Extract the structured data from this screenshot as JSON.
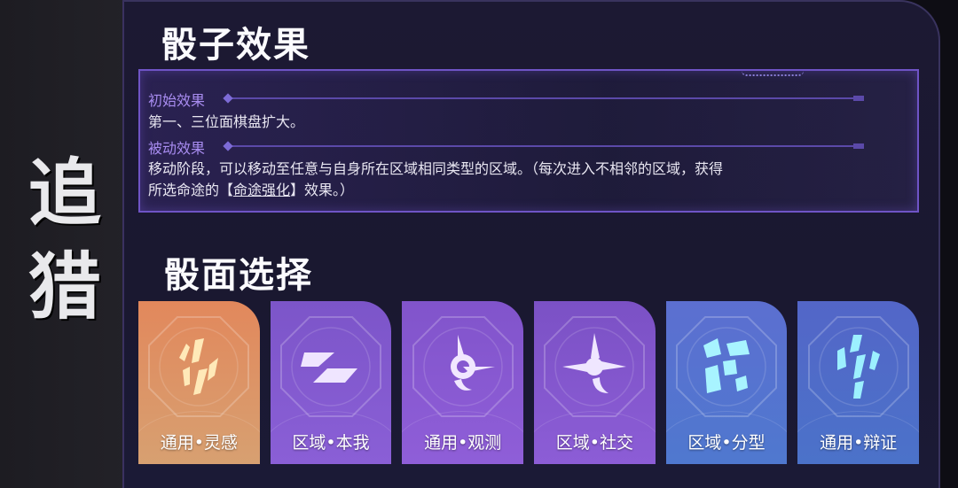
{
  "side_title": [
    "追",
    "猎"
  ],
  "dice_effect": {
    "title": "骰子效果",
    "initial_label": "初始效果",
    "initial_text": "第一、三位面棋盘扩大。",
    "passive_label": "被动效果",
    "passive_text_1": "移动阶段，可以移动至任意与自身所在区域相同类型的区域。（每次进入不相邻的区域，获得",
    "passive_text_2a": "所选命途的【",
    "passive_text_2b": "命途强化",
    "passive_text_2c": "】效果。）"
  },
  "face_select": {
    "title": "骰面选择",
    "faces": [
      {
        "label": "通用•灵感",
        "icon": "inspiration-icon",
        "color_top": "#e2885c",
        "color_bottom": "#d7a071",
        "glyph": "#ffe9b8"
      },
      {
        "label": "区域•本我",
        "icon": "self-icon",
        "color_top": "#7c55c9",
        "color_bottom": "#8a5fd6",
        "glyph": "#efe5ff"
      },
      {
        "label": "通用•观测",
        "icon": "observe-icon",
        "color_top": "#8154cb",
        "color_bottom": "#8f5ed8",
        "glyph": "#f1e7ff"
      },
      {
        "label": "区域•社交",
        "icon": "social-icon",
        "color_top": "#7b51c5",
        "color_bottom": "#8c5dd6",
        "glyph": "#efe6ff"
      },
      {
        "label": "区域•分型",
        "icon": "fractal-icon",
        "color_top": "#5c6fd0",
        "color_bottom": "#4f78cf",
        "glyph": "#a8f4ff"
      },
      {
        "label": "通用•辩证",
        "icon": "dialectic-icon",
        "color_top": "#5366c8",
        "color_bottom": "#4b72c9",
        "glyph": "#9cf0ff"
      }
    ]
  }
}
